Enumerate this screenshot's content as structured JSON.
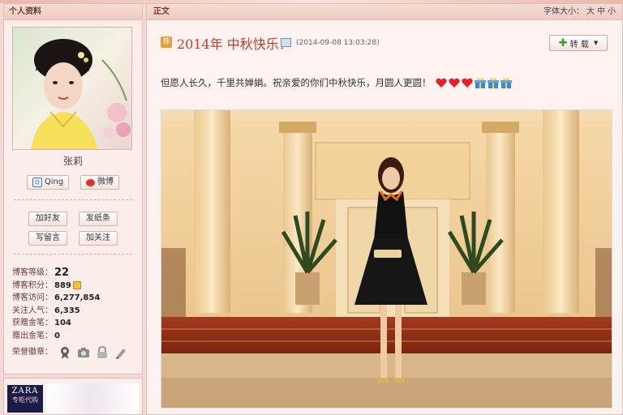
{
  "profile": {
    "panel_title": "个人资料",
    "name": "张莉",
    "qing_label": "Qing",
    "weibo_label": "微博",
    "buttons": [
      "加好友",
      "发纸条",
      "写留言",
      "加关注"
    ],
    "stats": {
      "level_label": "博客等级：",
      "level_value": "22",
      "points_label": "博客积分：",
      "points_value": "889",
      "visits_label": "博客访问：",
      "visits_value": "6,277,854",
      "followers_label": "关注人气：",
      "followers_value": "6,335",
      "gold_received_label": "获赠金笔：",
      "gold_received_value": "104",
      "gold_given_label": "赠出金笔：",
      "gold_given_value": "0",
      "honor_label": "荣誉徽章："
    },
    "badges": [
      "ribbon-medal-icon",
      "camera-icon",
      "lock-icon",
      "pen-icon"
    ]
  },
  "ad": {
    "brand": "ZARA",
    "subtitle": "专柜代购"
  },
  "article": {
    "panel_title": "正文",
    "font_size_label": "字体大小：",
    "font_sizes": [
      "大",
      "中",
      "小"
    ],
    "tag": "荐",
    "title": "2014年 中秋快乐！",
    "timestamp": "(2014-09-08 13:03:28)",
    "repost_label": "转 载",
    "body": "但愿人长久，千里共婵娟。祝亲爱的你们中秋快乐，月圆人更圆！",
    "emoticons": [
      "heart",
      "heart",
      "heart",
      "gift",
      "gift",
      "gift"
    ]
  },
  "colors": {
    "accent": "#c43a2e",
    "panel_bg": "#fbeeea",
    "panel_border": "#e4bdb4"
  }
}
